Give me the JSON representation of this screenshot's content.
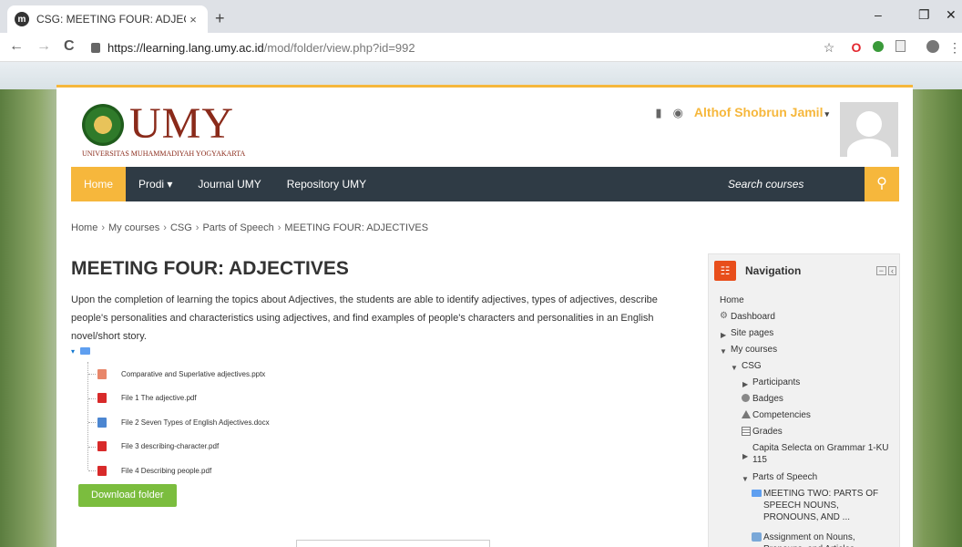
{
  "browser": {
    "tab_title": "CSG: MEETING FOUR: ADJECTIVE",
    "tab_favicon": "m",
    "tab_close": "×",
    "new_tab": "+",
    "url_host": "https://learning.lang.umy.ac.id",
    "url_path": "/mod/folder/view.php?id=992",
    "minimize": "–",
    "restore": "❐",
    "close": "✕",
    "back": "←",
    "forward": "→",
    "reload": "C",
    "star": "☆"
  },
  "site": {
    "logo_text": "UMY",
    "logo_subtitle": "UNIVERSITAS MUHAMMADIYAH YOGYAKARTA",
    "user_name": "Althof Shobrun Jamil",
    "user_caret": "▾",
    "accent_color": "#f6b73c",
    "nav_color": "#2f3b45"
  },
  "nav": {
    "items": [
      "Home",
      "Prodi ▾",
      "Journal UMY",
      "Repository UMY"
    ],
    "search_placeholder": "Search courses",
    "search_icon": "⚲"
  },
  "breadcrumb": [
    "Home",
    "My courses",
    "CSG",
    "Parts of Speech",
    "MEETING FOUR: ADJECTIVES"
  ],
  "breadcrumb_sep": "›",
  "main": {
    "title": "MEETING FOUR: ADJECTIVES",
    "description": "Upon the completion of learning the topics about Adjectives, the students are able to identify adjectives, types of adjectives, describe people's personalities and characteristics using adjectives, and find examples of people's characters and personalities in an English novel/short story.",
    "root_caret": "▾",
    "files": [
      {
        "name": "Comparative and Superlative adjectives.pptx",
        "type": "pptx"
      },
      {
        "name": "File 1 The adjective.pdf",
        "type": "pdf"
      },
      {
        "name": "File 2 Seven Types of English Adjectives.docx",
        "type": "docx"
      },
      {
        "name": "File 3 describing-character.pdf",
        "type": "pdf"
      },
      {
        "name": "File 4 Describing people.pdf",
        "type": "pdf"
      }
    ],
    "download_label": "Download folder"
  },
  "navigation_block": {
    "title": "Navigation",
    "items": [
      {
        "label": "Home",
        "indent": 0,
        "icon": "none"
      },
      {
        "label": "Dashboard",
        "indent": 0,
        "icon": "dashboard-icon"
      },
      {
        "label": "Site pages",
        "indent": 0,
        "icon": "caret-right",
        "caret": "▶"
      },
      {
        "label": "My courses",
        "indent": 0,
        "icon": "caret-down",
        "caret": "▼"
      },
      {
        "label": "CSG",
        "indent": 1,
        "icon": "caret-down",
        "caret": "▼"
      },
      {
        "label": "Participants",
        "indent": 2,
        "icon": "caret-right",
        "caret": "▶"
      },
      {
        "label": "Badges",
        "indent": 2,
        "icon": "badge-icon"
      },
      {
        "label": "Competencies",
        "indent": 2,
        "icon": "competency-icon"
      },
      {
        "label": "Grades",
        "indent": 2,
        "icon": "grades-icon"
      },
      {
        "label": "Capita Selecta on Grammar 1-KU 115",
        "indent": 2,
        "icon": "caret-right",
        "caret": "▶"
      },
      {
        "label": "Parts of Speech",
        "indent": 2,
        "icon": "caret-down",
        "caret": "▼"
      },
      {
        "label": "MEETING TWO: PARTS OF SPEECH NOUNS, PRONOUNS, AND ...",
        "indent": 3,
        "icon": "folder-icon"
      },
      {
        "label": "Assignment on Nouns, Pronouns, and Articles",
        "indent": 3,
        "icon": "assignment-icon"
      }
    ]
  }
}
